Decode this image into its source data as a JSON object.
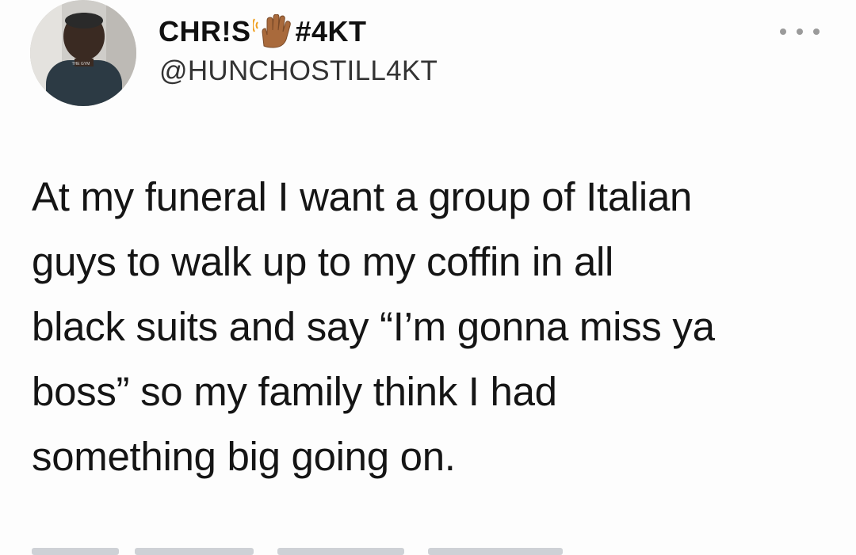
{
  "user": {
    "name_before_emoji": "CHR!S",
    "emoji": "waving-hand-icon",
    "name_after_emoji": "#4KT",
    "handle": "@HUNCHOSTILL4KT",
    "avatar_caption": "THE GYM"
  },
  "menu": {
    "icon": "more-options-icon"
  },
  "tweet": {
    "lines": [
      "At my funeral I want a group of Italian",
      "guys to walk up to my coffin in all",
      "black suits and say “I’m gonna miss ya",
      "boss” so my family think I had",
      "something big going on."
    ]
  },
  "colors": {
    "background": "#fdfdfd",
    "text": "#151515",
    "handle": "#333333",
    "menu_dots": "#9a9a9a"
  }
}
